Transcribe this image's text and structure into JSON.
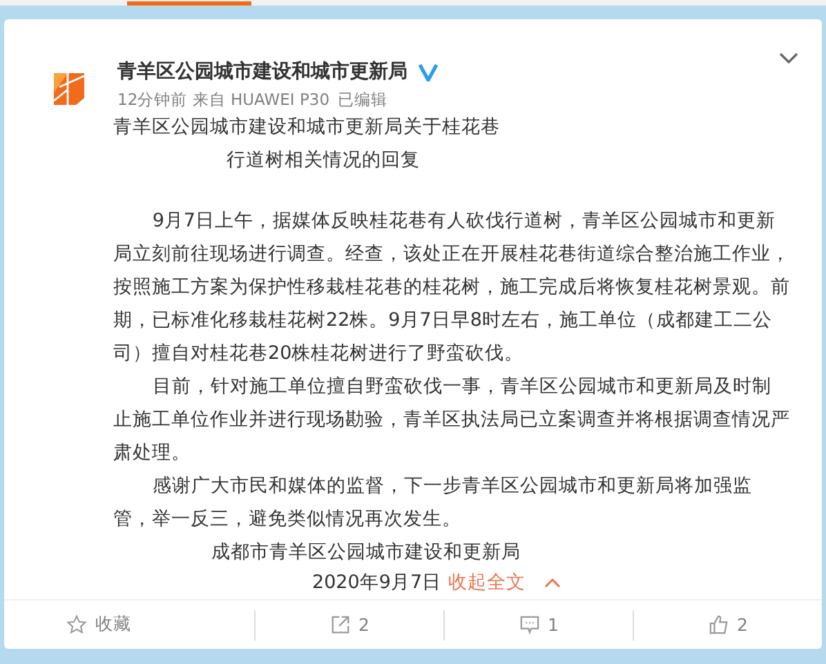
{
  "post": {
    "author": "青羊区公园城市建设和城市更新局",
    "verified": true,
    "time": "12分钟前",
    "source": "来自 HUAWEI P30",
    "edited": "已编辑",
    "title_lines": [
      "青羊区公园城市建设和城市更新局关于桂花巷",
      "行道树相关情况的回复"
    ],
    "paragraphs": [
      "9月7日上午，据媒体反映桂花巷有人砍伐行道树，青羊区公园城市和更新局立刻前往现场进行调查。经查，该处正在开展桂花巷街道综合整治施工作业，按照施工方案为保护性移栽桂花巷的桂花树，施工完成后将恢复桂花树景观。前期，已标准化移栽桂花树22株。9月7日早8时左右，施工单位（成都建工二公司）擅自对桂花巷20株桂花树进行了野蛮砍伐。",
      "目前，针对施工单位擅自野蛮砍伐一事，青羊区公园城市和更新局及时制止施工单位作业并进行现场勘验，青羊区执法局已立案调查并将根据调查情况严肃处理。",
      "感谢广大市民和媒体的监督，下一步青羊区公园城市和更新局将加强监管，举一反三，避免类似情况再次发生。"
    ],
    "signature": "成都市青羊区公园城市建设和更新局",
    "date": "2020年9月7日",
    "collapse_link": "收起全文"
  },
  "actions": [
    {
      "kind": "favorite",
      "label": "收藏"
    },
    {
      "kind": "repost",
      "label": "2"
    },
    {
      "kind": "comment",
      "label": "1"
    },
    {
      "kind": "like",
      "label": "2"
    }
  ]
}
